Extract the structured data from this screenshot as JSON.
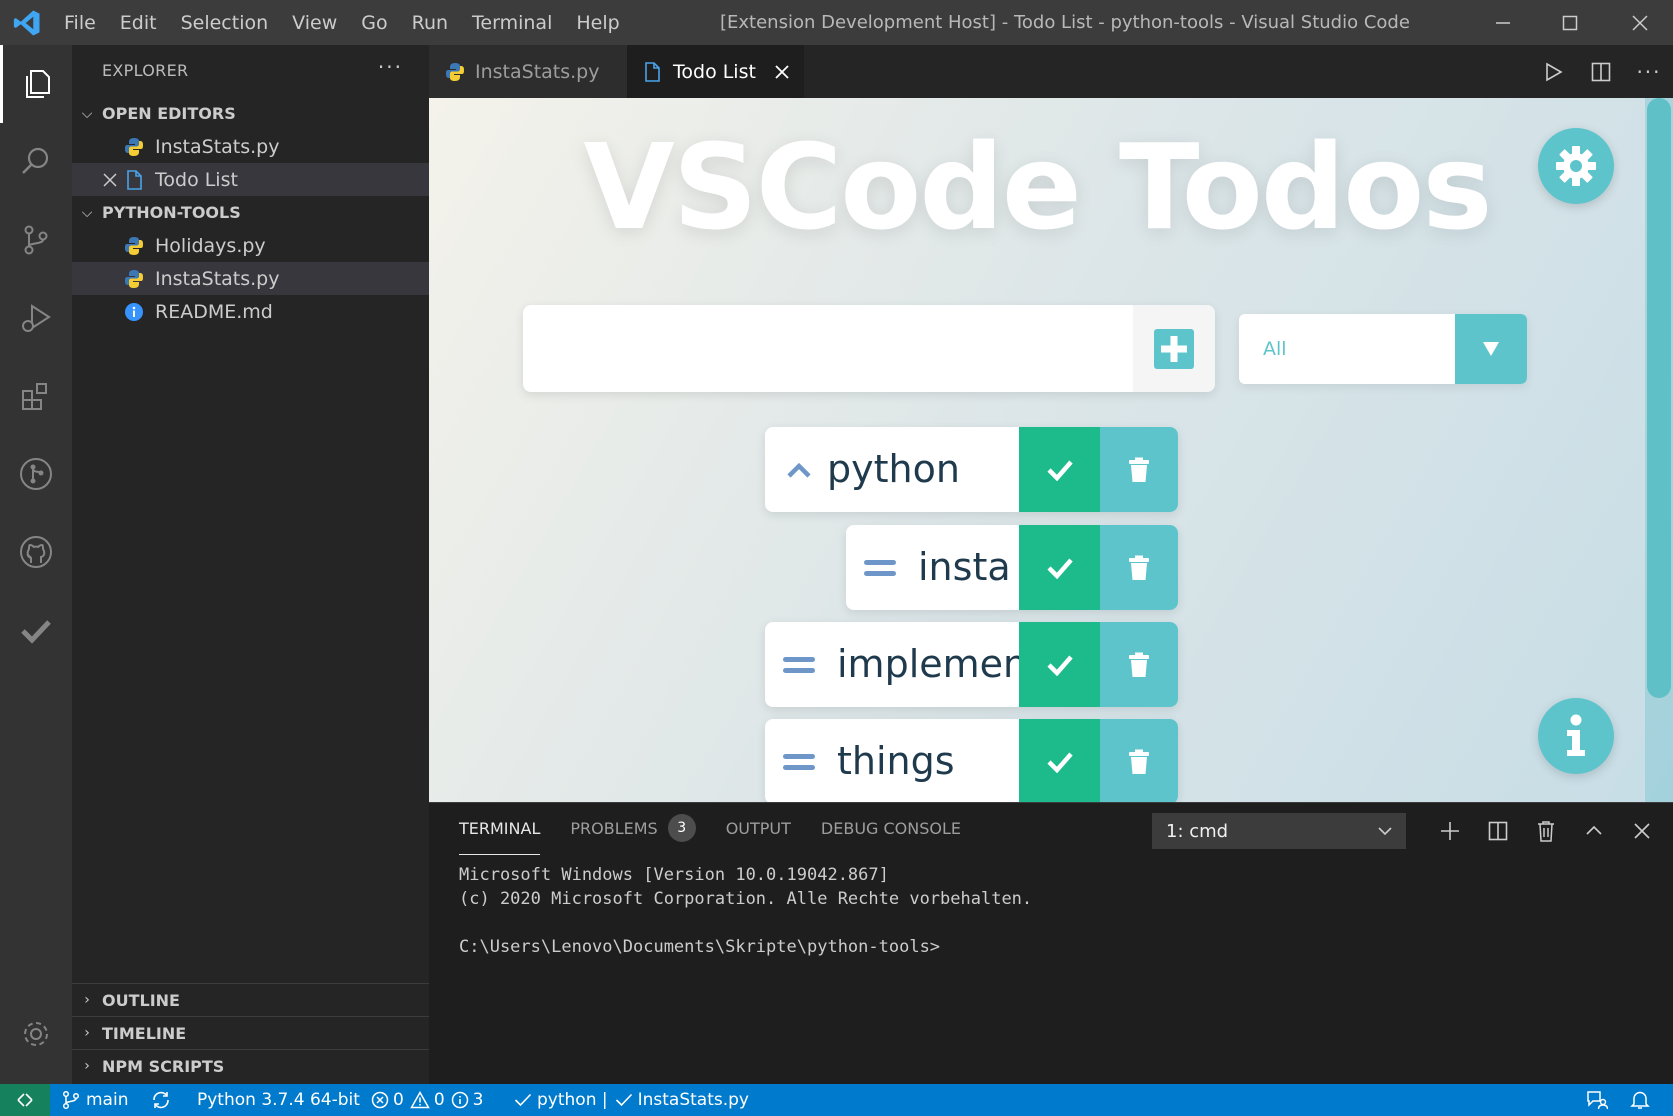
{
  "titlebar": {
    "menu": [
      "File",
      "Edit",
      "Selection",
      "View",
      "Go",
      "Run",
      "Terminal",
      "Help"
    ],
    "window_title": "[Extension Development Host] - Todo List - python-tools - Visual Studio Code"
  },
  "sidebar": {
    "header": "EXPLORER",
    "open_editors_label": "OPEN EDITORS",
    "open_editors": [
      "InstaStats.py",
      "Todo List"
    ],
    "folder_label": "PYTHON-TOOLS",
    "files": [
      "Holidays.py",
      "InstaStats.py",
      "README.md"
    ],
    "outline_label": "OUTLINE",
    "timeline_label": "TIMELINE",
    "npm_label": "NPM SCRIPTS"
  },
  "tabs": [
    "InstaStats.py",
    "Todo List"
  ],
  "webview": {
    "title": "VSCode Todos",
    "input_placeholder": "",
    "filter_value": "All",
    "todos": [
      "python",
      "insta",
      "implement",
      "things"
    ]
  },
  "panel": {
    "tab_terminal": "TERMINAL",
    "tab_problems": "PROBLEMS",
    "problems_count": "3",
    "tab_output": "OUTPUT",
    "tab_debug": "DEBUG CONSOLE",
    "terminal_select": "1: cmd",
    "lines": [
      "Microsoft Windows [Version 10.0.19042.867]",
      "(c) 2020 Microsoft Corporation. Alle Rechte vorbehalten.",
      "",
      "C:\\Users\\Lenovo\\Documents\\Skripte\\python-tools>"
    ]
  },
  "statusbar": {
    "branch": "main",
    "interpreter": "Python 3.7.4 64-bit",
    "errors": "0",
    "warnings": "0",
    "infos": "3",
    "lint": "python |",
    "file": "InstaStats.py"
  },
  "colors": {
    "accent": "#5ec4cb",
    "check": "#1dbb8b",
    "statusbar": "#007acc"
  }
}
